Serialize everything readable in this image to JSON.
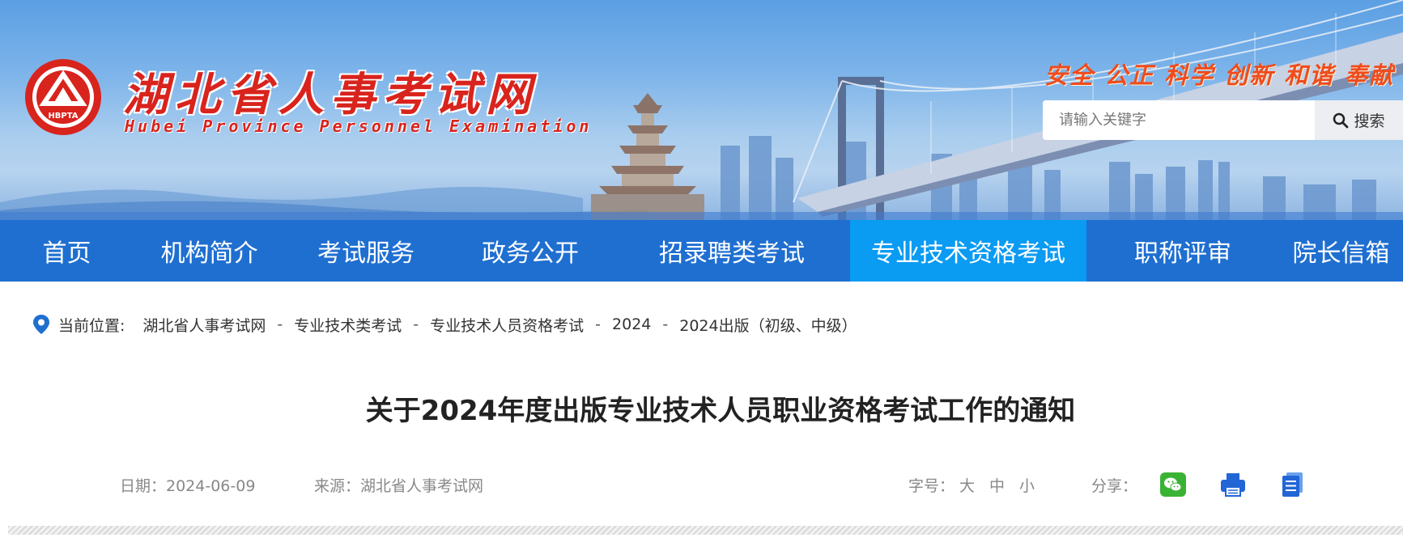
{
  "colors": {
    "nav_bg": "#1f6fd1",
    "nav_active_bg": "#0a9bf3",
    "logo_red": "#d9231d",
    "slogan_orange": "#f04b1c",
    "wechat_green": "#3ab233",
    "icon_blue": "#2266d6"
  },
  "header": {
    "emblem_text": "HBPTA",
    "logo_cn": "湖北省人事考试网",
    "logo_en": "Hubei Province Personnel Examination",
    "slogan": "安全 公正 科学 创新 和谐 奉献",
    "search": {
      "placeholder": "请输入关键字",
      "button_label": "搜索",
      "button_icon": "search-icon"
    }
  },
  "nav": {
    "items": [
      {
        "label": "首页"
      },
      {
        "label": "机构简介"
      },
      {
        "label": "考试服务"
      },
      {
        "label": "政务公开"
      },
      {
        "label": "招录聘类考试"
      },
      {
        "label": "专业技术资格考试",
        "active": true
      },
      {
        "label": "职称评审"
      },
      {
        "label": "院长信箱"
      }
    ]
  },
  "breadcrumb": {
    "icon": "location-pin-icon",
    "label": "当前位置:",
    "separator": "-",
    "items": [
      "湖北省人事考试网",
      "专业技术类考试",
      "专业技术人员资格考试",
      "2024",
      "2024出版（初级、中级）"
    ]
  },
  "article": {
    "title": "关于2024年度出版专业技术人员职业资格考试工作的通知",
    "date_text": "日期：2024-06-09",
    "source_text": "来源：湖北省人事考试网",
    "font_size_label": "字号：",
    "font_size_options": [
      "大",
      "中",
      "小"
    ],
    "share_label": "分享：",
    "share_icons": [
      "wechat-icon",
      "print-icon",
      "document-icon"
    ]
  }
}
